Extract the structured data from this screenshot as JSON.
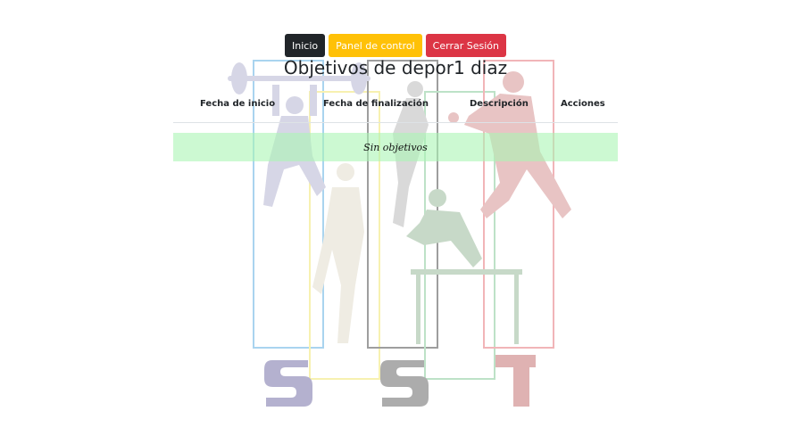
{
  "nav": {
    "home_label": "Inicio",
    "panel_label": "Panel de control",
    "logout_label": "Cerrar Sesión"
  },
  "page": {
    "title": "Objetivos de depor1 diaz"
  },
  "table": {
    "headers": [
      "Fecha de inicio",
      "Fecha de finalización",
      "Descripción",
      "Acciones"
    ],
    "empty_message": "Sin objetivos"
  },
  "colors": {
    "dark": "#212529",
    "warning": "#ffc107",
    "danger": "#dc3545",
    "empty_row": "#b8f5c0"
  }
}
